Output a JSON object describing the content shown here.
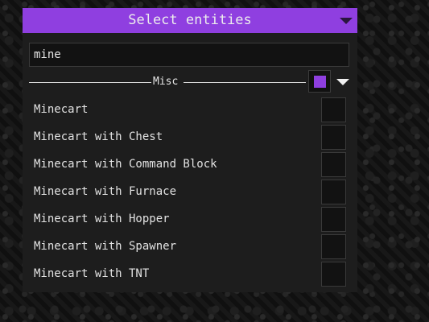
{
  "header": {
    "title": "Select entities"
  },
  "search": {
    "value": "mine"
  },
  "category": {
    "label": "Misc",
    "all_checked": true
  },
  "entities": [
    {
      "label": "Minecart",
      "checked": false
    },
    {
      "label": "Minecart with Chest",
      "checked": false
    },
    {
      "label": "Minecart with Command Block",
      "checked": false
    },
    {
      "label": "Minecart with Furnace",
      "checked": false
    },
    {
      "label": "Minecart with Hopper",
      "checked": false
    },
    {
      "label": "Minecart with Spawner",
      "checked": false
    },
    {
      "label": "Minecart with TNT",
      "checked": false
    }
  ],
  "colors": {
    "accent": "#8f3fe0",
    "panel": "#1d1d1d"
  },
  "icons": {
    "header_toggle": "chevron-down-icon",
    "category_toggle": "chevron-down-icon"
  }
}
